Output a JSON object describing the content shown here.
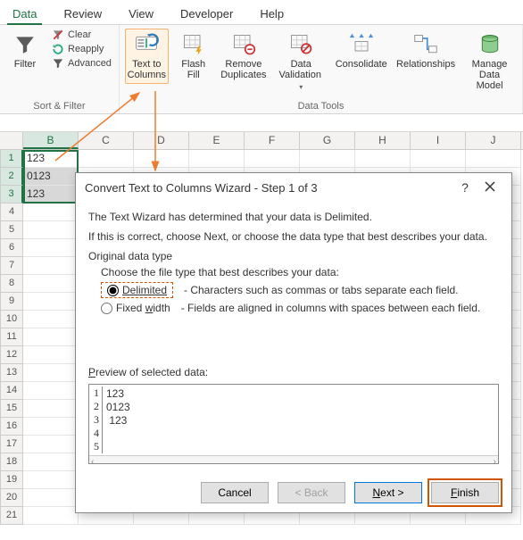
{
  "tabs": {
    "data": "Data",
    "review": "Review",
    "view": "View",
    "developer": "Developer",
    "help": "Help"
  },
  "ribbon": {
    "sort_filter": {
      "filter": "Filter",
      "clear": "Clear",
      "reapply": "Reapply",
      "advanced": "Advanced",
      "group": "Sort & Filter"
    },
    "data_tools": {
      "text_to_columns": "Text to\nColumns",
      "flash_fill": "Flash\nFill",
      "remove_duplicates": "Remove\nDuplicates",
      "data_validation": "Data\nValidation",
      "consolidate": "Consolidate",
      "relationships": "Relationships",
      "manage_data_model": "Manage\nData Model",
      "group": "Data Tools"
    }
  },
  "grid": {
    "col_headers": [
      "B",
      "C",
      "D",
      "E",
      "F",
      "G",
      "H",
      "I",
      "J"
    ],
    "rows": [
      {
        "n": "1",
        "b": "123"
      },
      {
        "n": "2",
        "b": "0123"
      },
      {
        "n": "3",
        "b": " 123"
      },
      {
        "n": "4",
        "b": ""
      },
      {
        "n": "5",
        "b": ""
      },
      {
        "n": "6",
        "b": ""
      },
      {
        "n": "7",
        "b": ""
      },
      {
        "n": "8",
        "b": ""
      },
      {
        "n": "9",
        "b": ""
      },
      {
        "n": "10",
        "b": ""
      },
      {
        "n": "11",
        "b": ""
      },
      {
        "n": "12",
        "b": ""
      },
      {
        "n": "13",
        "b": ""
      },
      {
        "n": "14",
        "b": ""
      },
      {
        "n": "15",
        "b": ""
      },
      {
        "n": "16",
        "b": ""
      },
      {
        "n": "17",
        "b": ""
      },
      {
        "n": "18",
        "b": ""
      },
      {
        "n": "19",
        "b": ""
      },
      {
        "n": "20",
        "b": ""
      },
      {
        "n": "21",
        "b": ""
      }
    ]
  },
  "dialog": {
    "title": "Convert Text to Columns Wizard - Step 1 of 3",
    "intro1": "The Text Wizard has determined that your data is Delimited.",
    "intro2": "If this is correct, choose Next, or choose the data type that best describes your data.",
    "group_label": "Original data type",
    "choose": "Choose the file type that best describes your data:",
    "delimited": "Delimited",
    "delimited_desc": "- Characters such as commas or tabs separate each field.",
    "fixed": "Fixed width",
    "fixed_desc": "- Fields are aligned in columns with spaces between each field.",
    "preview_label": "Preview of selected data:",
    "preview_rows": [
      {
        "n": "1",
        "v": "123"
      },
      {
        "n": "2",
        "v": "0123"
      },
      {
        "n": "3",
        "v": " 123"
      },
      {
        "n": "4",
        "v": ""
      },
      {
        "n": "5",
        "v": ""
      }
    ],
    "buttons": {
      "cancel": "Cancel",
      "back": "< Back",
      "next": "Next >",
      "finish": "Finish"
    }
  }
}
